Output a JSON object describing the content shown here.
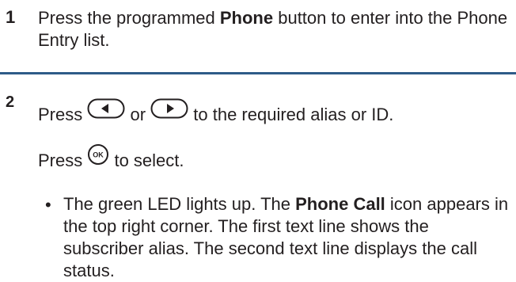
{
  "step1": {
    "number": "1",
    "text_before": "Press the programmed ",
    "bold": "Phone",
    "text_after": " button to enter into the Phone Entry list."
  },
  "step2": {
    "number": "2",
    "line1_press": "Press ",
    "line1_or": " or ",
    "line1_rest": " to the required alias or ID.",
    "line2_press": "Press ",
    "line2_rest": " to select.",
    "ok_label": "OK",
    "bullet_glyph": "•",
    "bullet_before": "The green LED lights up. The ",
    "bullet_bold": "Phone Call",
    "bullet_after": " icon appears in the top right corner. The first text line shows the subscriber alias. The second text line displays the call status."
  },
  "icons": [
    "left-arrow-key-icon",
    "right-arrow-key-icon",
    "ok-button-icon"
  ],
  "colors": {
    "text": "#231f20",
    "rule": "#2e5b88"
  }
}
